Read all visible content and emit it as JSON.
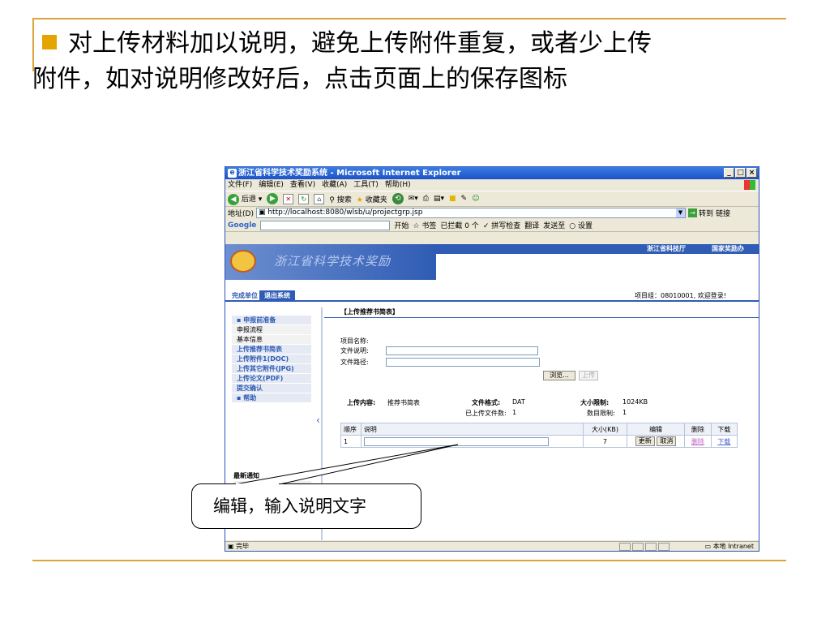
{
  "slide": {
    "bullet_line1": "对上传材料加以说明，避免上传附件重复，或者少上传",
    "bullet_line2": "附件，如对说明修改好后，点击页面上的保存图标",
    "callout_text": "编辑，输入说明文字",
    "accent_color": "#d9a43a",
    "bullet_color": "#e5a400"
  },
  "window": {
    "title": "浙江省科学技术奖励系统 - Microsoft Internet Explorer",
    "menus": [
      "文件(F)",
      "编辑(E)",
      "查看(V)",
      "收藏(A)",
      "工具(T)",
      "帮助(H)"
    ],
    "toolbar": {
      "back": "后退",
      "search": "搜索",
      "favorites": "收藏夹"
    },
    "address": {
      "label": "地址(D)",
      "url": "http://localhost:8080/wlsb/u/projectgrp.jsp",
      "go": "转到",
      "links": "链接"
    },
    "google_bar": {
      "logo": "Google",
      "start": "开始",
      "bookmarks": "书签",
      "blocked": "已拦截 0 个",
      "spell": "拼写检查",
      "translate": "翻译",
      "send_to": "发送至",
      "settings": "设置"
    },
    "status": {
      "left": "完毕",
      "zone": "本地 Intranet"
    }
  },
  "page": {
    "banner_title": "浙江省科学技术奖励",
    "banner_links": [
      "浙江省科技厅",
      "国家奖励办"
    ],
    "nav_tabs": [
      "完成单位",
      "退出系统"
    ],
    "user_info": "项目组：08010001, 欢迎登录!",
    "sidebar": [
      "▪ 申报前准备",
      "申报流程",
      "基本信息",
      "上传推荐书简表",
      "上传附件1(DOC)",
      "上传其它附件(JPG)",
      "上传论文(PDF)",
      "提交确认",
      "▪ 帮助"
    ],
    "notice_title": "最新通知",
    "section_title": "【上传推荐书简表】",
    "form": {
      "project_name_label": "项目名称:",
      "file_desc_label": "文件说明:",
      "file_path_label": "文件路径:",
      "browse": "浏览...",
      "upload": "上传"
    },
    "info": {
      "content_label": "上传内容:",
      "content_value": "推荐书简表",
      "format_label": "文件格式:",
      "format_value": "DAT",
      "size_label": "大小限制:",
      "size_value": "1024KB",
      "uploaded_label": "已上传文件数:",
      "uploaded_value": "1",
      "count_label": "数目限制:",
      "count_value": "1"
    },
    "table": {
      "headers": [
        "顺序",
        "说明",
        "大小(KB)",
        "编辑",
        "删除",
        "下载"
      ],
      "rows": [
        {
          "order": "1",
          "size": "7",
          "update": "更新",
          "cancel": "取消",
          "delete": "删除",
          "download": "下载"
        }
      ]
    }
  }
}
